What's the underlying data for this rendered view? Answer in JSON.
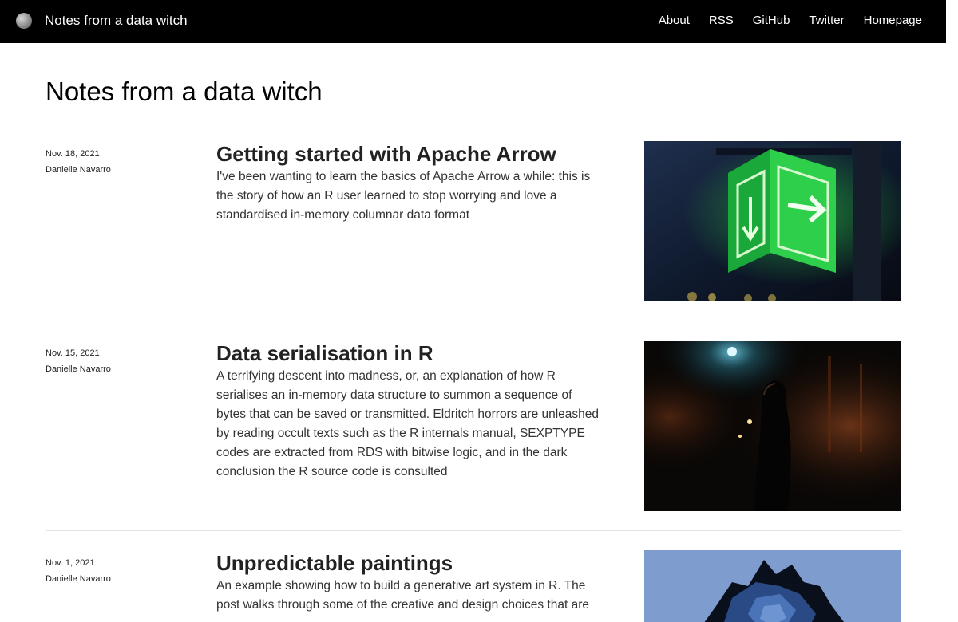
{
  "navbar": {
    "brand": "Notes from a data witch",
    "links": [
      "About",
      "RSS",
      "GitHub",
      "Twitter",
      "Homepage"
    ]
  },
  "page": {
    "title": "Notes from a data witch"
  },
  "posts": [
    {
      "date": "Nov. 18, 2021",
      "author": "Danielle Navarro",
      "title": "Getting started with Apache Arrow",
      "description": "I've been wanting to learn the basics of Apache Arrow a while: this is the story of how an R user learned to stop worrying and love a standardised in-memory columnar data format"
    },
    {
      "date": "Nov. 15, 2021",
      "author": "Danielle Navarro",
      "title": "Data serialisation in R",
      "description": "A terrifying descent into madness, or, an explanation of how R serialises an in-memory data structure to summon a sequence of bytes that can be saved or transmitted. Eldritch horrors are unleashed by reading occult texts such as the R internals manual, SEXPTYPE codes are extracted from RDS with bitwise logic, and in the dark conclusion the R source code is consulted"
    },
    {
      "date": "Nov. 1, 2021",
      "author": "Danielle Navarro",
      "title": "Unpredictable paintings",
      "description": "An example showing how to build a generative art system in R. The post walks through some of the creative and design choices that are"
    }
  ],
  "colors": {
    "navbar_bg": "#000000",
    "text": "#222222",
    "divider": "#e3e3e3"
  }
}
